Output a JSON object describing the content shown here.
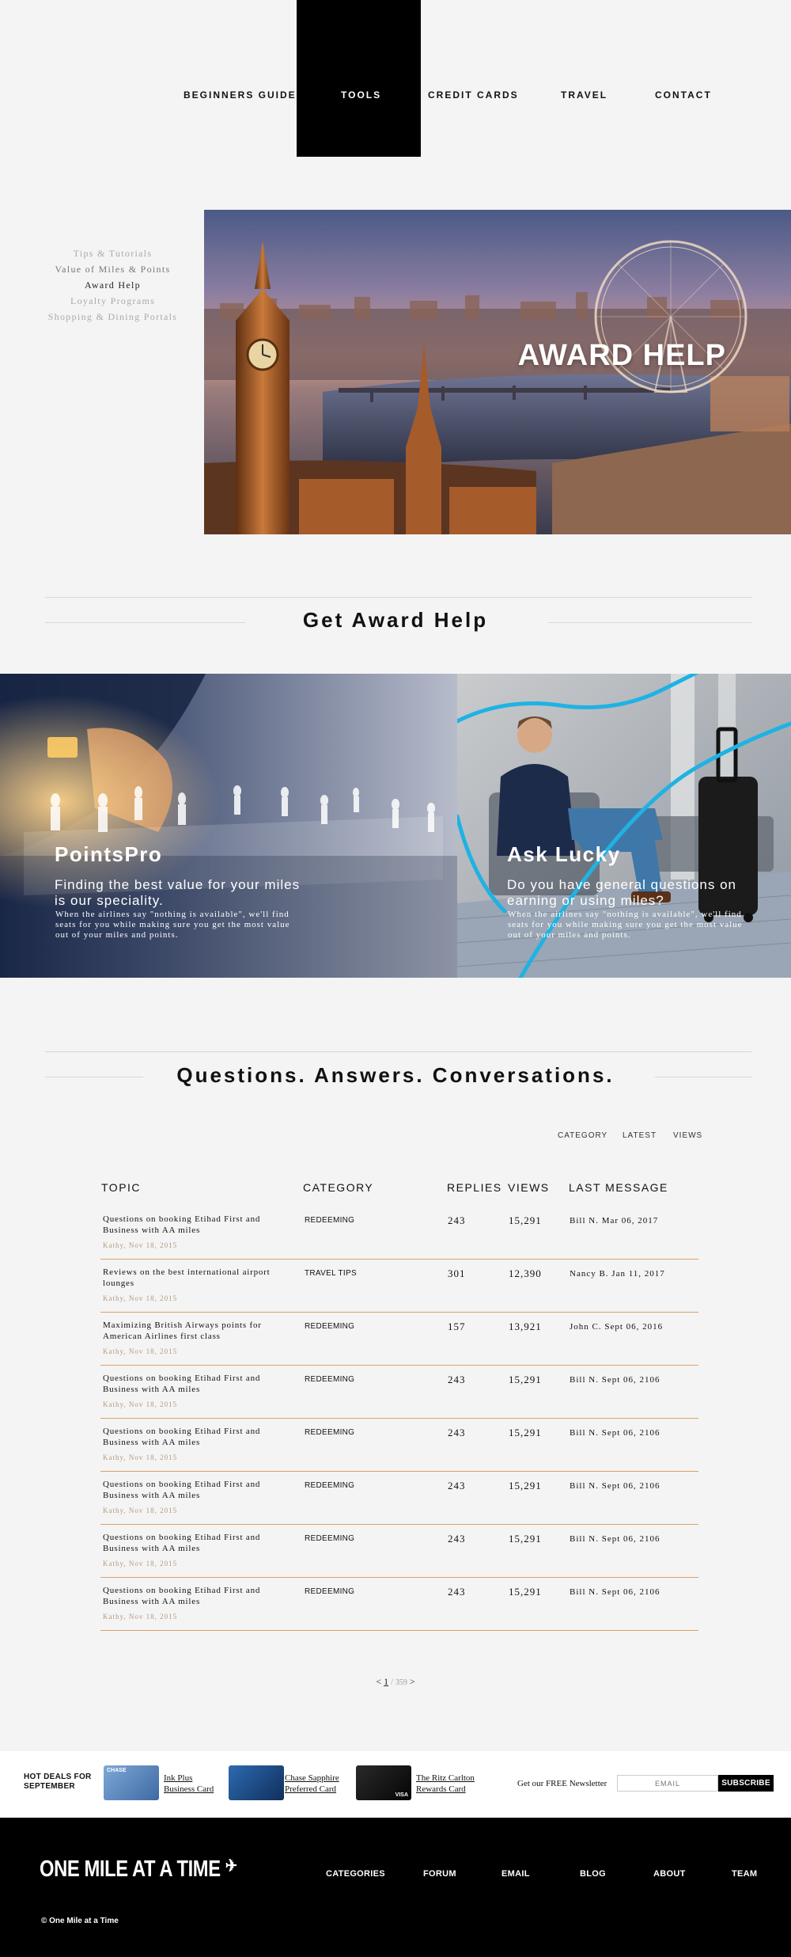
{
  "nav": {
    "items": [
      "BEGINNERS GUIDE",
      "TOOLS",
      "CREDIT CARDS",
      "TRAVEL",
      "CONTACT"
    ],
    "active_index": 1
  },
  "sidebar": {
    "items": [
      "Tips & Tutorials",
      "Value of Miles & Points",
      "Award Help",
      "Loyalty Programs",
      "Shopping & Dining Portals"
    ],
    "current_index": 2
  },
  "hero": {
    "title": "AWARD HELP"
  },
  "section_award": {
    "title": "Get Award Help"
  },
  "cards": [
    {
      "title": "PointsPro",
      "subtitle": "Finding the best value for your miles is our speciality.",
      "description": "When the airlines say \"nothing is available\", we'll find seats for you while making sure you get the most value out of your miles and points."
    },
    {
      "title": "Ask Lucky",
      "subtitle": "Do you have general questions on earning or using miles?",
      "description": "When the airlines say \"nothing is available\", we'll find seats for you while making sure you get the most value out of your miles and points."
    }
  ],
  "section_forum": {
    "title": "Questions. Answers. Conversations."
  },
  "sort": {
    "options": [
      "CATEGORY",
      "LATEST",
      "VIEWS"
    ]
  },
  "table": {
    "headers": [
      "TOPIC",
      "CATEGORY",
      "REPLIES",
      "VIEWS",
      "LAST MESSAGE"
    ],
    "rows": [
      {
        "topic": "Questions on booking Etihad First and Business with AA miles",
        "author": "Kathy, Nov 18, 2015",
        "category": "REDEEMING",
        "replies": "243",
        "views": "15,291",
        "last": "Bill N. Mar 06, 2017"
      },
      {
        "topic": "Reviews on the best international airport lounges",
        "author": "Kathy, Nov 18, 2015",
        "category": "TRAVEL TIPS",
        "replies": "301",
        "views": "12,390",
        "last": "Nancy B. Jan 11, 2017"
      },
      {
        "topic": "Maximizing British Airways points for American Airlines first class",
        "author": "Kathy, Nov 18, 2015",
        "category": "REDEEMING",
        "replies": "157",
        "views": "13,921",
        "last": "John C. Sept 06, 2016"
      },
      {
        "topic": "Questions on booking Etihad First and Business with AA miles",
        "author": "Kathy, Nov 18, 2015",
        "category": "REDEEMING",
        "replies": "243",
        "views": "15,291",
        "last": "Bill N. Sept 06, 2106"
      },
      {
        "topic": "Questions on booking Etihad First and Business with AA miles",
        "author": "Kathy, Nov 18, 2015",
        "category": "REDEEMING",
        "replies": "243",
        "views": "15,291",
        "last": "Bill N. Sept 06, 2106"
      },
      {
        "topic": "Questions on booking Etihad First and Business with AA miles",
        "author": "Kathy, Nov 18, 2015",
        "category": "REDEEMING",
        "replies": "243",
        "views": "15,291",
        "last": "Bill N. Sept 06, 2106"
      },
      {
        "topic": "Questions on booking Etihad First and Business with AA miles",
        "author": "Kathy, Nov 18, 2015",
        "category": "REDEEMING",
        "replies": "243",
        "views": "15,291",
        "last": "Bill N. Sept 06, 2106"
      },
      {
        "topic": "Questions on booking Etihad First and Business with AA miles",
        "author": "Kathy, Nov 18, 2015",
        "category": "REDEEMING",
        "replies": "243",
        "views": "15,291",
        "last": "Bill N. Sept 06, 2106"
      }
    ]
  },
  "pagination": {
    "prev": "<",
    "current": "1",
    "separator": "/",
    "total": "359",
    "next": ">"
  },
  "deals": {
    "title_line1": "HOT DEALS FOR",
    "title_line2": "SEPTEMBER",
    "cards": [
      {
        "line1": "Ink Plus",
        "line2": "Business Card",
        "card_brand": "CHASE",
        "color": "#5a86bd"
      },
      {
        "line1": "Chase Sapphire",
        "line2": "Preferred Card",
        "color": "#1f4f8a"
      },
      {
        "line1": "The Ritz Carlton",
        "line2": "Rewards Card",
        "card_brand": "VISA",
        "color": "#151515"
      }
    ]
  },
  "newsletter": {
    "label": "Get our FREE Newsletter",
    "placeholder": "EMAIL",
    "button": "SUBSCRIBE"
  },
  "footer": {
    "logo": "ONE MILE AT A TIME",
    "nav": [
      "CATEGORIES",
      "FORUM",
      "EMAIL",
      "BLOG",
      "ABOUT",
      "TEAM"
    ],
    "copyright": "© One Mile at a Time"
  },
  "colors": {
    "accent_rule": "#d9a168",
    "hero_title": "#ffffff",
    "footer_bg": "#000000"
  }
}
